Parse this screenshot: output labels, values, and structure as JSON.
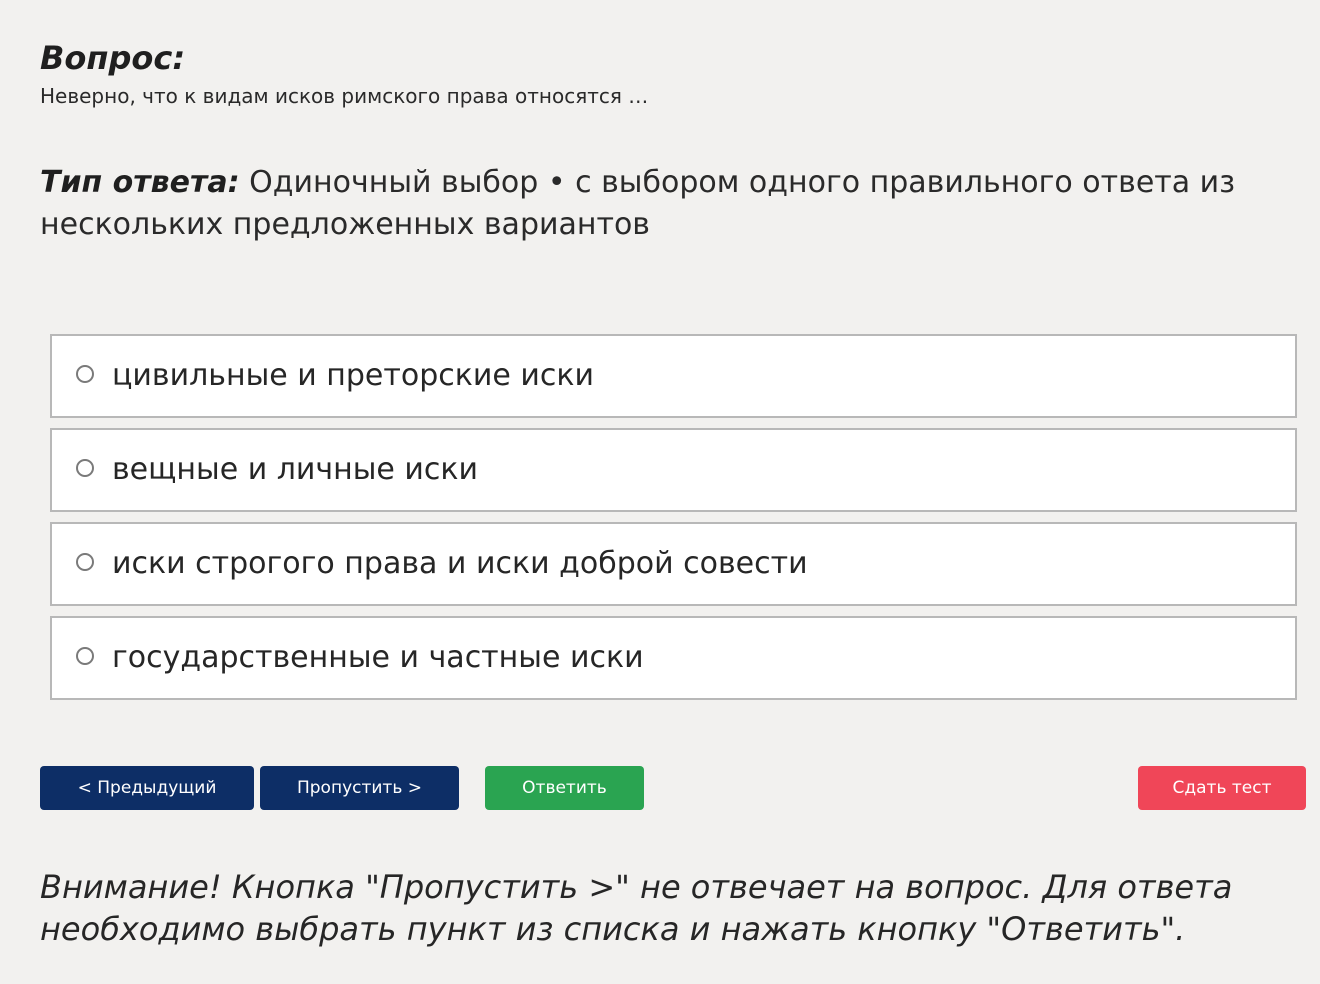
{
  "question": {
    "heading": "Вопрос:",
    "text": "Неверно, что к видам исков римского права относятся …"
  },
  "answer_type": {
    "label": "Тип ответа:",
    "value": " Одиночный выбор • с выбором одного правильного ответа из нескольких предложенных вариантов"
  },
  "options": [
    {
      "label": "цивильные и преторские иски"
    },
    {
      "label": "вещные и личные иски"
    },
    {
      "label": "иски строгого права и иски доброй совести"
    },
    {
      "label": "государственные и частные иски"
    }
  ],
  "buttons": {
    "prev": "< Предыдущий",
    "skip": "Пропустить >",
    "answer": "Ответить",
    "finish": "Сдать тест"
  },
  "colors": {
    "nav_button": "#0d2e66",
    "answer_button": "#2aa451",
    "finish_button": "#f04658",
    "background": "#f2f1ef"
  },
  "warning": "Внимание! Кнопка \"Пропустить >\" не отвечает на вопрос. Для ответа необходимо выбрать пункт из списка и нажать кнопку \"Ответить\"."
}
